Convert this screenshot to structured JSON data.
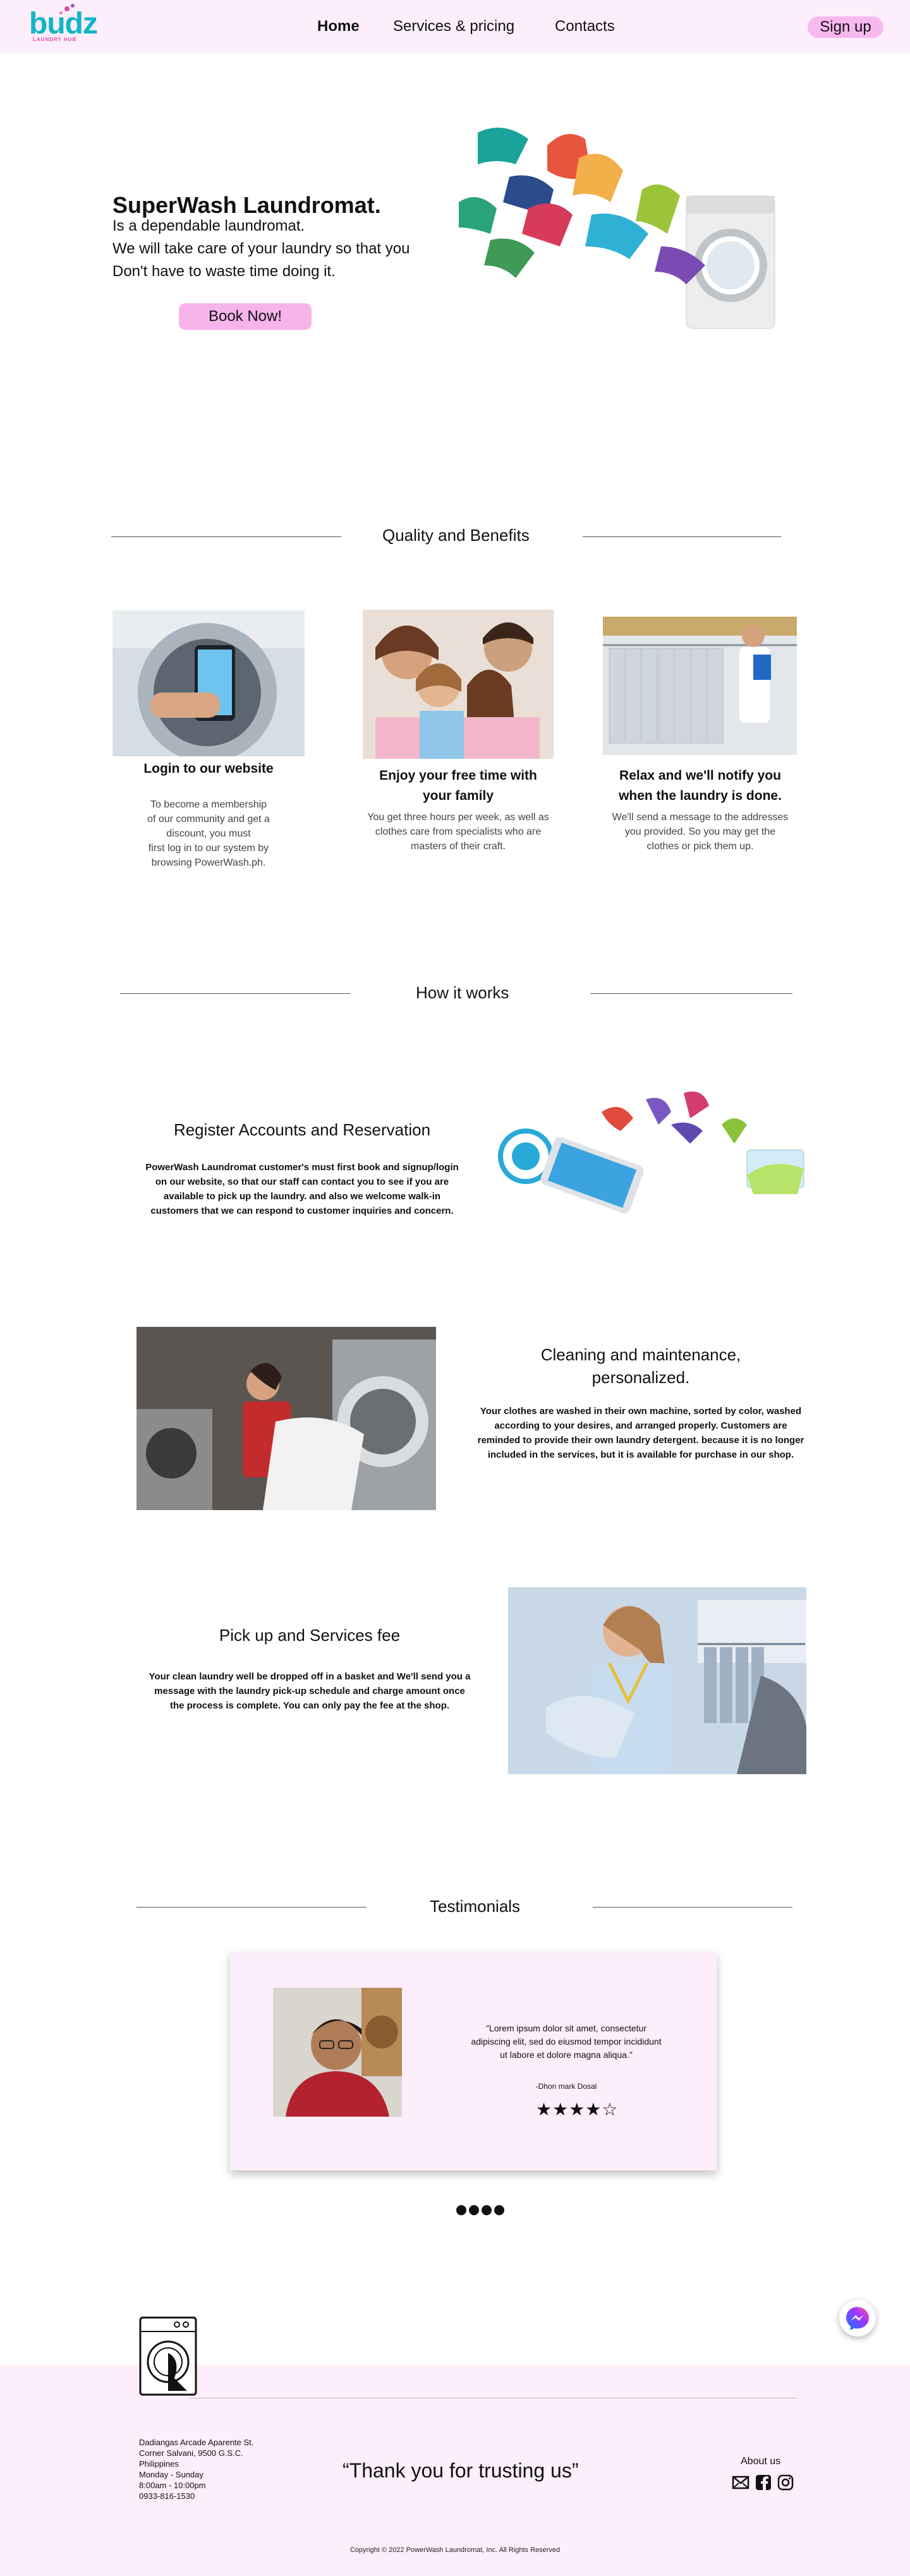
{
  "nav": {
    "logo_text": "budz",
    "logo_tagline": "LAUNDRY HUB",
    "links": [
      "Home",
      "Services & pricing",
      "Contacts"
    ],
    "signup_label": "Sign up"
  },
  "hero": {
    "title": "SuperWash Laundromat.",
    "lines": [
      "Is a dependable laundromat.",
      "We will take care of your laundry so that you",
      "Don't have to waste time doing it."
    ],
    "cta_label": "Book Now!"
  },
  "quality": {
    "heading": "Quality and Benefits",
    "cards": [
      {
        "title": "Login to our website",
        "text_lines": [
          "To become a membership",
          "of our community and get a",
          "discount, you must",
          "first log in to our system by",
          "browsing PowerWash.ph."
        ]
      },
      {
        "title_lines": [
          "Enjoy your free time with",
          "your family"
        ],
        "text_lines": [
          "You get three hours per week, as well as",
          "clothes care from specialists who are",
          "masters of their craft."
        ]
      },
      {
        "title_lines": [
          "Relax and we'll notify you",
          "when the laundry is done."
        ],
        "text_lines": [
          "We'll send a message to the addresses",
          "you provided. So you may get the",
          "clothes or pick them up."
        ]
      }
    ]
  },
  "how": {
    "heading": "How it works",
    "steps": [
      {
        "title_lines": [
          "Register Accounts and Reservation"
        ],
        "text_lines": [
          "PowerWash Laundromat customer's must first book and signup/login",
          "on our website, so that our staff can contact you to see if you are",
          "available to pick up the laundry. and also we welcome walk-in",
          "customers that we can respond to customer inquiries and concern."
        ]
      },
      {
        "title_lines": [
          "Cleaning and maintenance,",
          "personalized."
        ],
        "text_lines": [
          "Your clothes are washed in their own machine, sorted by color, washed",
          "according to your desires, and arranged properly. Customers are",
          "reminded to provide their own laundry detergent. because it is no longer",
          "included in the services, but it is available for purchase in our shop."
        ]
      },
      {
        "title_lines": [
          "Pick up and Services fee"
        ],
        "text_lines": [
          "Your clean laundry well be dropped off in a basket and We'll send you a",
          "message with the laundry pick-up schedule and charge amount once",
          "the process is complete. You can only pay the fee at the shop."
        ]
      }
    ]
  },
  "testimonials": {
    "heading": "Testimonials",
    "quote_lines": [
      "\"Lorem ipsum dolor sit amet, consectetur",
      "adipiscing elit, sed do eiusmod tempor incididunt",
      "ut labore et dolore magna aliqua.\""
    ],
    "author": "-Dhon mark Dosal",
    "stars": "★★★★☆",
    "rating": 4,
    "rating_max": 5,
    "page_dots": 4
  },
  "footer": {
    "address_lines": [
      "Dadiangas Arcade Aparente St.",
      "Corner Salvani, 9500 G.S.C.",
      "Philippines",
      "Monday - Sunday",
      "8:00am - 10:00pm",
      "0933-816-1530"
    ],
    "thanks": "“Thank you for trusting us”",
    "about_label": "About us",
    "social_icons": [
      "mail-icon",
      "facebook-icon",
      "instagram-icon"
    ],
    "copyright": "Copyright © 2022 PowerWash Laundromat, Inc. All Rights Reserved"
  },
  "colors": {
    "nav_bg": "#fdeefb",
    "button_pink": "#f7b8ee",
    "logo_teal": "#11b5c8",
    "logo_pink": "#e8469a"
  }
}
